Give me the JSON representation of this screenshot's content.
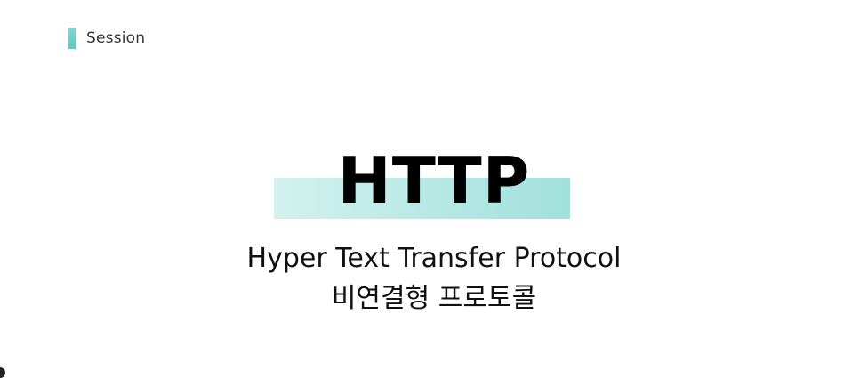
{
  "header": {
    "section_label": "Session"
  },
  "slide": {
    "title": "HTTP",
    "subtitle": "Hyper Text Transfer Protocol",
    "korean_subtitle": "비연결형 프로토콜"
  },
  "colors": {
    "accent": "#5ccbc1",
    "highlight": "#b7e8e4",
    "text": "#111111",
    "background": "#ffffff"
  }
}
